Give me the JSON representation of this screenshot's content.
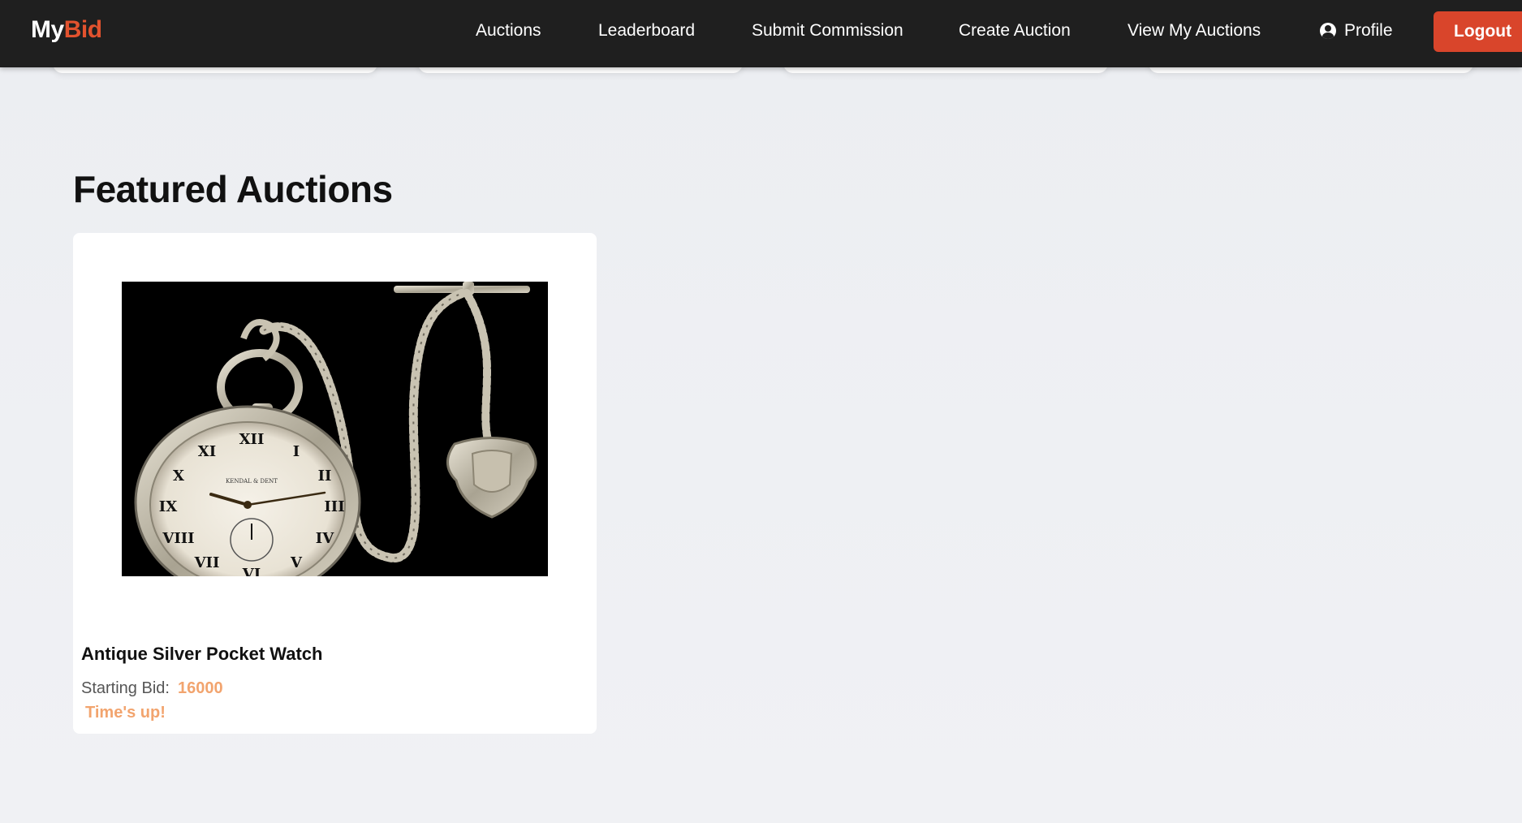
{
  "header": {
    "logo_part1": "My",
    "logo_part2": "Bid",
    "nav": [
      {
        "label": "Auctions"
      },
      {
        "label": "Leaderboard"
      },
      {
        "label": "Submit Commission"
      },
      {
        "label": "Create Auction"
      },
      {
        "label": "View My Auctions"
      },
      {
        "label": "Profile",
        "icon": "user-circle-icon"
      }
    ],
    "logout_label": "Logout"
  },
  "featured": {
    "title": "Featured Auctions",
    "items": [
      {
        "name": "Antique Silver Pocket Watch",
        "starting_bid_label": "Starting Bid:",
        "starting_bid_value": "16000",
        "status": "Time's up!",
        "image": "pocket-watch-image"
      }
    ]
  },
  "colors": {
    "header_bg": "#1f1f1f",
    "brand_accent": "#e2522e",
    "logout_bg": "#d9452b",
    "highlight": "#f2a46e"
  }
}
